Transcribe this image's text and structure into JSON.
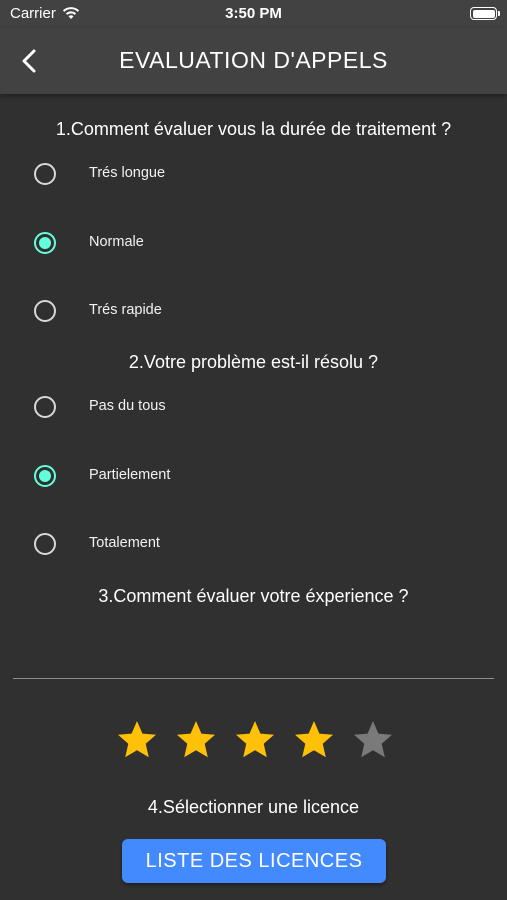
{
  "status_bar": {
    "carrier": "Carrier",
    "time": "3:50 PM"
  },
  "header": {
    "title": "EVALUATION D'APPELS",
    "back_icon": "chevron-left-icon"
  },
  "questions": [
    {
      "text": "1.Comment évaluer vous la durée de traitement ?",
      "options": [
        {
          "label": "Trés longue",
          "selected": false
        },
        {
          "label": "Normale",
          "selected": true
        },
        {
          "label": "Trés rapide",
          "selected": false
        }
      ]
    },
    {
      "text": "2.Votre problème est-il résolu ?",
      "options": [
        {
          "label": "Pas du tous",
          "selected": false
        },
        {
          "label": "Partielement",
          "selected": true
        },
        {
          "label": "Totalement",
          "selected": false
        }
      ]
    },
    {
      "text": "3.Comment évaluer votre éxperience ?"
    }
  ],
  "rating": {
    "value": 4,
    "max": 5,
    "filled_color": "#ffc107",
    "empty_color": "#7a7a7a"
  },
  "license": {
    "prompt": "4.Sélectionner une licence",
    "button_label": "LISTE DES LICENCES"
  },
  "colors": {
    "background": "#303030",
    "app_bar": "#424242",
    "radio_selected": "#64ffda",
    "button": "#448aff"
  }
}
